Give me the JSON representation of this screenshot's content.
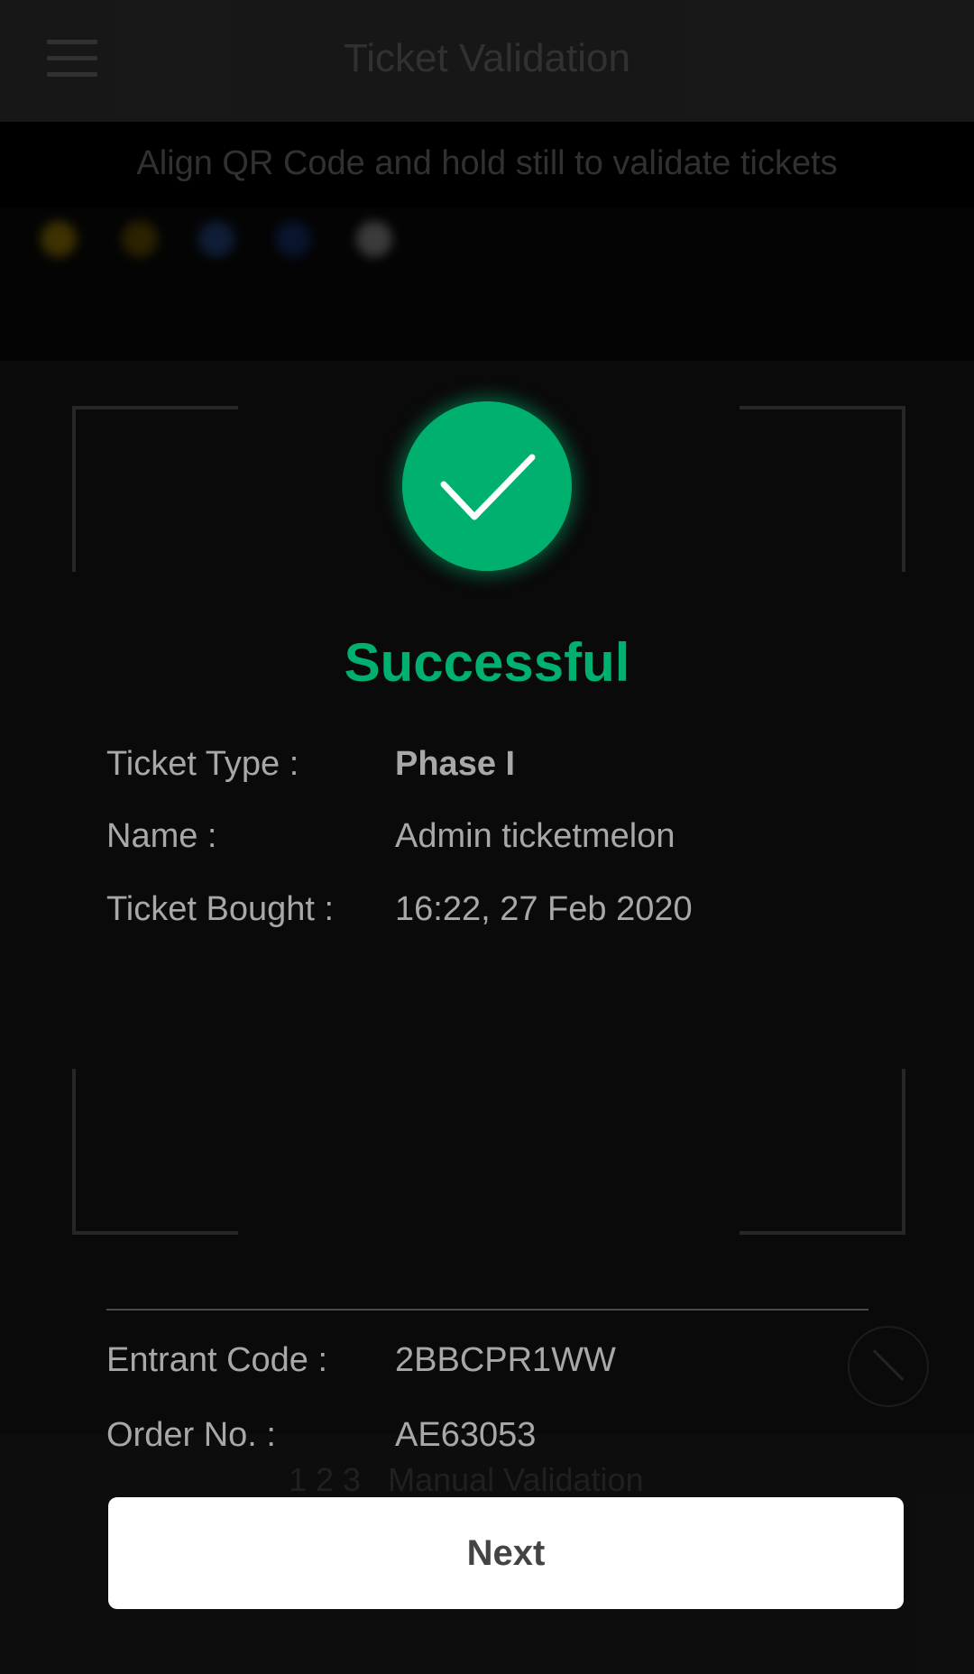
{
  "app": {
    "title": "Ticket Validation",
    "instructions": "Align QR Code and hold still to validate tickets",
    "manual_prefix": "1 2 3",
    "manual_label": "Manual Validation"
  },
  "result": {
    "status": "Successful",
    "status_color": "#00b06e",
    "ticket_type": {
      "label": "Ticket Type :",
      "value": "Phase I"
    },
    "name": {
      "label": "Name :",
      "value": "Admin ticketmelon"
    },
    "ticket_bought": {
      "label": "Ticket Bought :",
      "value": "16:22, 27 Feb 2020"
    },
    "entrant_code": {
      "label": "Entrant Code :",
      "value": "2BBCPR1WW"
    },
    "order_no": {
      "label": "Order No. :",
      "value": "AE63053"
    }
  },
  "actions": {
    "next_label": "Next"
  },
  "icons": {
    "success": "checkmark-icon",
    "menu": "menu-icon",
    "flash": "flash-off-icon"
  }
}
